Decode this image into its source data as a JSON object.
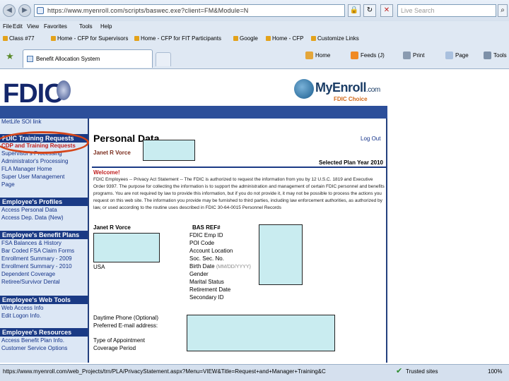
{
  "browser": {
    "address": "https://www.myenroll.com/scripts/baswec.exe?client=FM&Module=N",
    "search_placeholder": "Live Search",
    "menu": [
      "File",
      "Edit",
      "View",
      "Favorites",
      "Tools",
      "Help"
    ],
    "favorites": [
      "Class #77",
      "Home - CFP for Supervisors",
      "Home - CFP for FIT Participants",
      "Google",
      "Home - CFP",
      "Customize Links"
    ],
    "tab_title": "Benefit Allocation System",
    "commands": {
      "home": "Home",
      "feeds": "Feeds (J)",
      "print": "Print",
      "page": "Page",
      "tools": "Tools"
    }
  },
  "header": {
    "fdic_logo": "FDIC",
    "myenroll_logo": "MyEnroll",
    "myenroll_suffix": ".com",
    "myenroll_sub": "FDIC Choice"
  },
  "sidebar": {
    "top_link": "MetLife SOI link",
    "training_head": "FDIC Training Requests",
    "training_links": [
      "CDP and Training Requests",
      "Supervisor's Processing",
      "Administrator's Processing",
      "FLA Manager Home",
      "Super User Management",
      "Page"
    ],
    "profiles_head": "Employee's Profiles",
    "profiles_links": [
      "Access Personal Data",
      "Access Dep. Data (New)"
    ],
    "benefit_head": "Employee's Benefit Plans",
    "benefit_links": [
      "FSA Balances & History",
      "Bar Coded FSA Claim Forms",
      "Enrollment Summary - 2009",
      "Enrollment Summary - 2010",
      "Dependent Coverage",
      "Retiree/Survivor Dental"
    ],
    "webtools_head": "Employee's Web Tools",
    "webtools_links": [
      "Web Access Info",
      "Edit Logon Info."
    ],
    "resources_head": "Employee's Resources",
    "resources_links": [
      "Access Benefit Plan Info.",
      "Customer Service Options"
    ]
  },
  "main": {
    "title": "Personal Data",
    "logout": "Log Out",
    "user_name": "Janet R Vorce",
    "plan_year": "Selected Plan Year 2010",
    "welcome": "Welcome!",
    "notice": "FDIC Employees -- Privacy Act Statement -- The FDIC is authorized to request the information from you by 12 U.S.C. 1819 and Executive Order 9397. The purpose for collecting the information is to support the administration and management of certain FDIC personnel and benefits programs. You are not required by law to provide this information, but if you do not provide it, it may not be possible to process the actions you request on this web site. The information you provide may be furnished to third parties, including law enforcement authorities, as authorized by law, or used according to the routine uses described in FDIC 30-64-0015 Personnel Records",
    "name_label": "Janet R Vorce",
    "country": "USA",
    "fields": [
      "BAS REF#",
      "FDIC Emp ID",
      "POI Code",
      "Account Location",
      "Soc. Sec. No.",
      "Birth Date",
      "Gender",
      "Marital Status",
      "Retirement Date",
      "Secondary ID"
    ],
    "date_hint": "(MM/DD/YYYY)",
    "daytime_phone": "Daytime Phone (Optional)",
    "email": "Preferred E-mail address:",
    "appointment_type": "Type of Appointment",
    "coverage_period": "Coverage Period"
  },
  "status": {
    "url": "https://www.myenroll.com/web_Projects/trn/PLA/PrivacyStatement.aspx?Menu=VIEW&Title=Request+and+Manager+Training&C",
    "zone": "Trusted sites",
    "zoom": "100%"
  }
}
